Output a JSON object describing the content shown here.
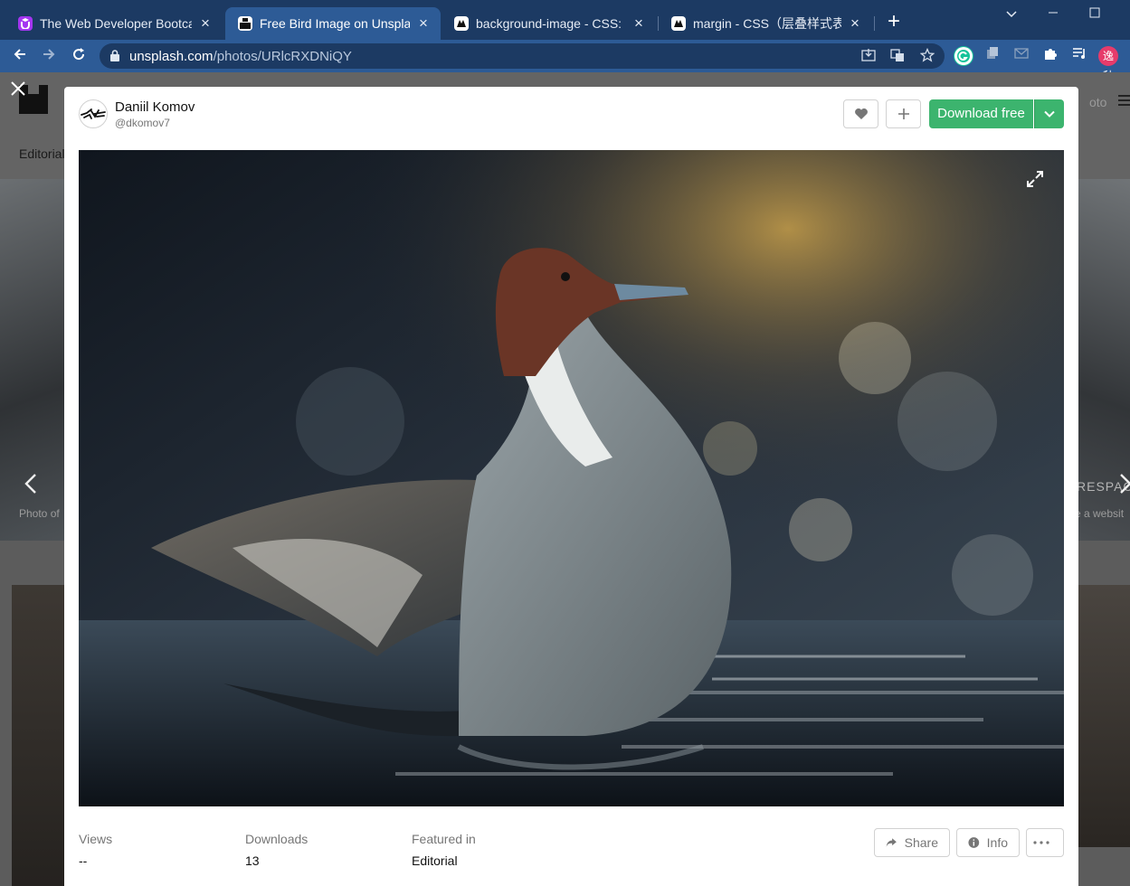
{
  "browser": {
    "tabs": [
      {
        "title": "The Web Developer Bootcamp",
        "favicon": "udemy-icon",
        "active": false
      },
      {
        "title": "Free Bird Image on Unsplash",
        "favicon": "unsplash-icon",
        "active": true
      },
      {
        "title": "background-image - CSS: Casc",
        "favicon": "mdn-icon",
        "active": false
      },
      {
        "title": "margin - CSS（层叠样式表）| M",
        "favicon": "mdn-icon",
        "active": false
      }
    ],
    "url_host": "unsplash.com",
    "url_path": "/photos/URlcRXDNiQY",
    "profile_badge": "逸秋",
    "colors": {
      "tabbar": "#1c3a63",
      "toolbar": "#2d5b96"
    }
  },
  "background_page": {
    "nav_item": "Editorial",
    "caption_left": "Photo of",
    "caption_right": "e a websit",
    "hero_right_text": "RESPAC",
    "header_right_text": "oto"
  },
  "modal": {
    "author": {
      "name": "Daniil Komov",
      "handle": "@dkomov7"
    },
    "actions": {
      "like": "heart-icon",
      "collect": "plus-icon",
      "download_label": "Download free",
      "download_caret": "chevron-down-icon"
    },
    "photo": {
      "alt": "Northern pintail duck flapping wings in water",
      "expand": "expand-icon"
    },
    "stats": [
      {
        "label": "Views",
        "value": "--"
      },
      {
        "label": "Downloads",
        "value": "13"
      },
      {
        "label": "Featured in",
        "value": "Editorial"
      }
    ],
    "buttons": {
      "share": "Share",
      "info": "Info",
      "more": "more-icon"
    },
    "colors": {
      "download": "#3cb46e"
    }
  }
}
